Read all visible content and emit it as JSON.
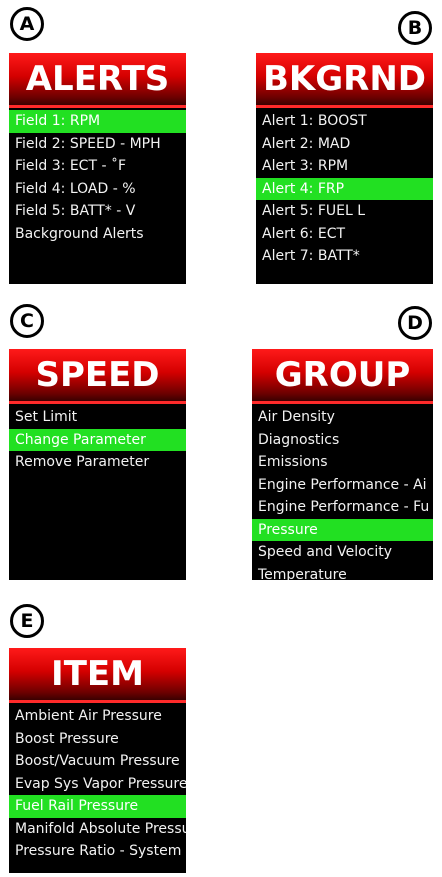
{
  "panels": {
    "A": {
      "badge": "A",
      "title": "ALERTS",
      "items": [
        "Field 1: RPM",
        "Field 2: SPEED  -  MPH",
        "Field 3: ECT    -  ˚F",
        "Field 4: LOAD  -  %",
        "Field 5: BATT*  -  V",
        "Background Alerts"
      ],
      "selected_index": 0
    },
    "B": {
      "badge": "B",
      "title": "BKGRND",
      "items": [
        "Alert 1: BOOST",
        "Alert 2: MAD",
        "Alert 3: RPM",
        "Alert 4: FRP",
        "Alert 5: FUEL L",
        "Alert 6: ECT",
        "Alert 7: BATT*"
      ],
      "selected_index": 3
    },
    "C": {
      "badge": "C",
      "title": "SPEED",
      "items": [
        "Set Limit",
        "Change Parameter",
        "Remove Parameter"
      ],
      "selected_index": 1
    },
    "D": {
      "badge": "D",
      "title": "GROUP",
      "items": [
        "Air Density",
        "Diagnostics",
        "Emissions",
        "Engine Performance - Ai",
        "Engine Performance - Fu",
        "Pressure",
        "Speed and Velocity",
        "Temperature"
      ],
      "selected_index": 5
    },
    "E": {
      "badge": "E",
      "title": "ITEM",
      "items": [
        "Ambient Air Pressure",
        "Boost Pressure",
        "Boost/Vacuum Pressure",
        "Evap Sys Vapor Pressure",
        "Fuel Rail Pressure",
        "Manifold Absolute Pressu",
        "Pressure Ratio - System"
      ],
      "selected_index": 4
    }
  },
  "colors": {
    "screen_bg": "#000000",
    "header_red": "#d40000",
    "selected_green": "#22e022",
    "text": "#f2f2f2"
  }
}
